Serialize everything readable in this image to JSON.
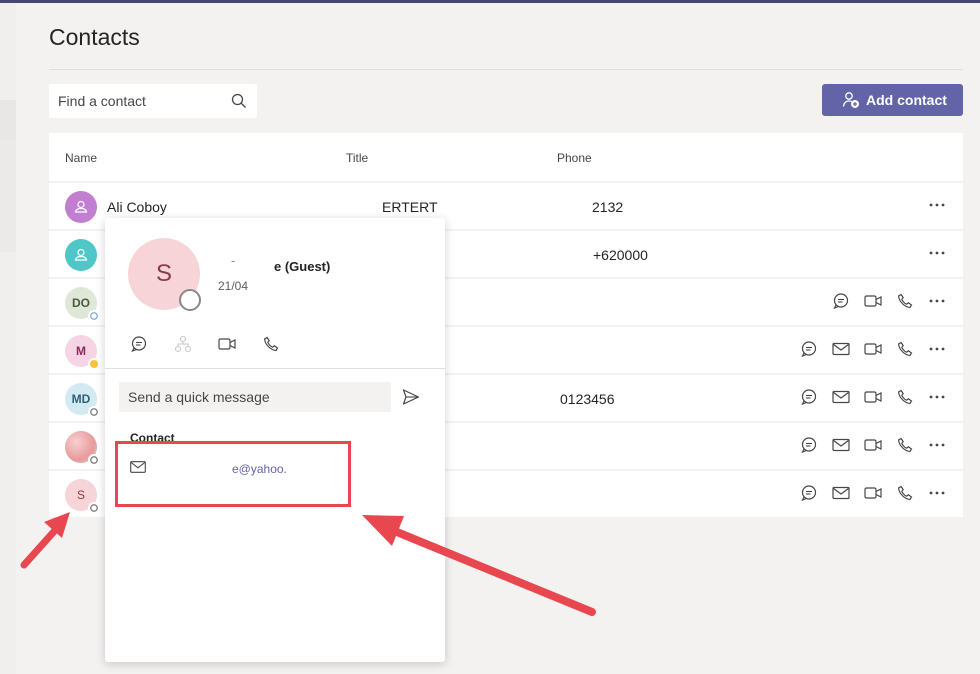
{
  "header": {
    "title": "Contacts"
  },
  "search": {
    "placeholder": "Find a contact"
  },
  "add_contact": {
    "label": "Add contact"
  },
  "columns": {
    "name": "Name",
    "title": "Title",
    "phone": "Phone"
  },
  "rows": [
    {
      "initials": "",
      "name": "Ali Coboy",
      "title": "ERTERT",
      "phone": "2132",
      "avatar_color": "#c27fd2"
    },
    {
      "initials": "",
      "name": "",
      "title": "",
      "phone": "+620000",
      "avatar_color": "#4fc7c9"
    },
    {
      "initials": "DO",
      "name": "",
      "title": "",
      "phone": "",
      "avatar_color": "#dfe8d8"
    },
    {
      "initials": "M",
      "name": "",
      "title": "",
      "phone": "",
      "avatar_color": "#f6d4e4"
    },
    {
      "initials": "MD",
      "name": "",
      "title": "",
      "phone": "0123456",
      "avatar_color": "#d4eaf2"
    },
    {
      "initials": "",
      "name": "",
      "title": "",
      "phone": "",
      "avatar_color": "#f2b8b8"
    },
    {
      "initials": "S",
      "name": "",
      "title": "",
      "phone": "",
      "avatar_color": "#f6d4d8"
    }
  ],
  "card": {
    "initial": "S",
    "name_partial": "e (Guest)",
    "name_fragment": "-",
    "subtitle": "21/04",
    "quick_message_placeholder": "Send a quick message",
    "contact_heading": "Contact",
    "email_partial": "e@yahoo."
  },
  "colors": {
    "accent": "#6264a7",
    "annotation": "#e8474f"
  }
}
